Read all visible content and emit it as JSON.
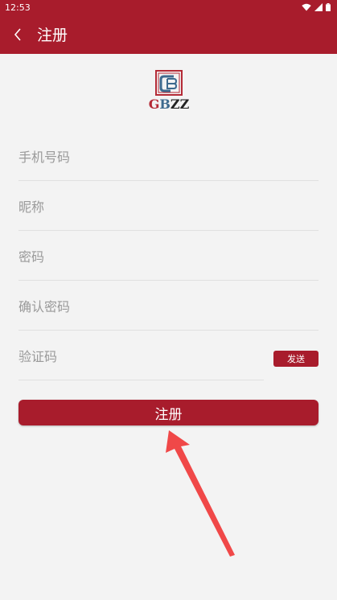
{
  "status_bar": {
    "time": "12:53"
  },
  "header": {
    "title": "注册"
  },
  "logo": {
    "text_g": "G",
    "text_b": "B",
    "text_zz": "ZZ",
    "colors": {
      "red": "#b42a36",
      "blue": "#3e6a8e",
      "dark": "#222222"
    }
  },
  "form": {
    "phone_placeholder": "手机号码",
    "nickname_placeholder": "昵称",
    "password_placeholder": "密码",
    "confirm_password_placeholder": "确认密码",
    "code_placeholder": "验证码",
    "send_label": "发送",
    "submit_label": "注册"
  },
  "theme": {
    "accent": "#a81c2c",
    "background": "#f3f3f3",
    "arrow": "#f04848"
  }
}
